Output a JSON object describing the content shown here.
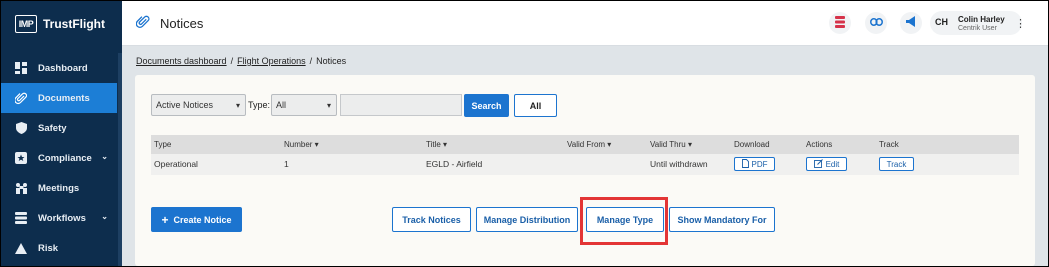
{
  "brand": {
    "logo_text": "IMP",
    "name": "TrustFlight"
  },
  "sidebar": {
    "items": [
      {
        "label": "Dashboard",
        "icon": "dashboard-icon",
        "active": false,
        "caret": false
      },
      {
        "label": "Documents",
        "icon": "paperclip-icon",
        "active": true,
        "caret": false
      },
      {
        "label": "Safety",
        "icon": "shield-icon",
        "active": false,
        "caret": false
      },
      {
        "label": "Compliance",
        "icon": "badge-icon",
        "active": false,
        "caret": true
      },
      {
        "label": "Meetings",
        "icon": "meetings-icon",
        "active": false,
        "caret": false
      },
      {
        "label": "Workflows",
        "icon": "workflow-icon",
        "active": false,
        "caret": true
      },
      {
        "label": "Risk",
        "icon": "warning-icon",
        "active": false,
        "caret": false
      }
    ]
  },
  "header": {
    "title": "Notices",
    "user": {
      "initials": "CH",
      "name": "Colin Harley",
      "role": "Centrik User"
    }
  },
  "breadcrumb": {
    "item1": "Documents dashboard",
    "sep": "/",
    "item2": "Flight Operations",
    "current": "Notices"
  },
  "filters": {
    "status_value": "Active Notices",
    "type_label": "Type:",
    "type_value": "All",
    "search_value": "",
    "search_button": "Search",
    "all_button": "All"
  },
  "table": {
    "headers": {
      "type": "Type",
      "number": "Number ▾",
      "title": "Title ▾",
      "valid_from": "Valid From ▾",
      "valid_thru": "Valid Thru ▾",
      "download": "Download",
      "actions": "Actions",
      "track": "Track"
    },
    "rows": [
      {
        "type": "Operational",
        "number": "1",
        "title": "EGLD - Airfield",
        "valid_from": "",
        "valid_thru": "Until withdrawn",
        "download": "PDF",
        "edit": "Edit",
        "track": "Track"
      }
    ]
  },
  "actions": {
    "create": "Create Notice",
    "track_notices": "Track Notices",
    "manage_distribution": "Manage Distribution",
    "manage_type": "Manage Type",
    "show_mandatory": "Show Mandatory For"
  },
  "colors": {
    "sidebar": "#0d2d4d",
    "accent": "#1c74cf",
    "highlight": "#e33535"
  }
}
